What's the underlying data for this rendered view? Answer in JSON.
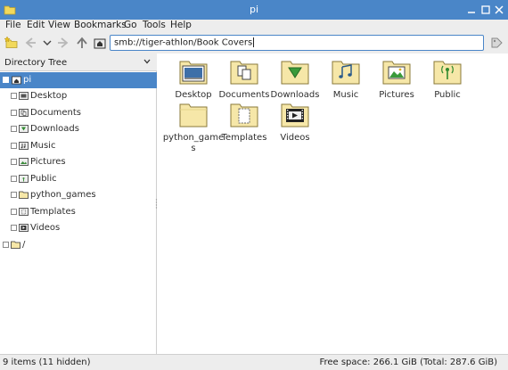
{
  "window": {
    "title": "pi",
    "controls": [
      "minimize-icon",
      "maximize-icon",
      "close-icon"
    ],
    "accent": "#4a86c8"
  },
  "menubar": {
    "items": [
      "File",
      "Edit",
      "View",
      "Bookmarks",
      "Go",
      "Tools",
      "Help"
    ]
  },
  "toolbar": {
    "path": "smb://tiger-athlon/Book Covers",
    "buttons": [
      "new-tab-icon",
      "back-icon",
      "history-dropdown-icon",
      "forward-icon",
      "up-icon",
      "home-icon",
      "go-icon"
    ]
  },
  "sidebar": {
    "header": "Directory Tree",
    "tree": [
      {
        "label": "pi",
        "icon": "home-folder-icon",
        "selected": true,
        "level": 0,
        "expanded": true
      },
      {
        "label": "Desktop",
        "icon": "desktop-folder-icon",
        "level": 1
      },
      {
        "label": "Documents",
        "icon": "documents-folder-icon",
        "level": 1
      },
      {
        "label": "Downloads",
        "icon": "downloads-folder-icon",
        "level": 1
      },
      {
        "label": "Music",
        "icon": "music-folder-icon",
        "level": 1
      },
      {
        "label": "Pictures",
        "icon": "pictures-folder-icon",
        "level": 1
      },
      {
        "label": "Public",
        "icon": "public-folder-icon",
        "level": 1
      },
      {
        "label": "python_games",
        "icon": "folder-icon",
        "level": 1
      },
      {
        "label": "Templates",
        "icon": "templates-folder-icon",
        "level": 1
      },
      {
        "label": "Videos",
        "icon": "videos-folder-icon",
        "level": 1
      },
      {
        "label": "/",
        "icon": "folder-icon",
        "level": 0
      }
    ]
  },
  "files": [
    {
      "label": "Desktop",
      "icon": "desktop-folder-icon"
    },
    {
      "label": "Documents",
      "icon": "documents-folder-icon"
    },
    {
      "label": "Downloads",
      "icon": "downloads-folder-icon"
    },
    {
      "label": "Music",
      "icon": "music-folder-icon"
    },
    {
      "label": "Pictures",
      "icon": "pictures-folder-icon"
    },
    {
      "label": "Public",
      "icon": "public-folder-icon"
    },
    {
      "label": "python_games",
      "icon": "folder-icon"
    },
    {
      "label": "Templates",
      "icon": "templates-folder-icon"
    },
    {
      "label": "Videos",
      "icon": "videos-folder-icon"
    }
  ],
  "status": {
    "items": "9 items (11 hidden)",
    "free_space": "Free space: 266.1 GiB (Total: 287.6 GiB)"
  }
}
